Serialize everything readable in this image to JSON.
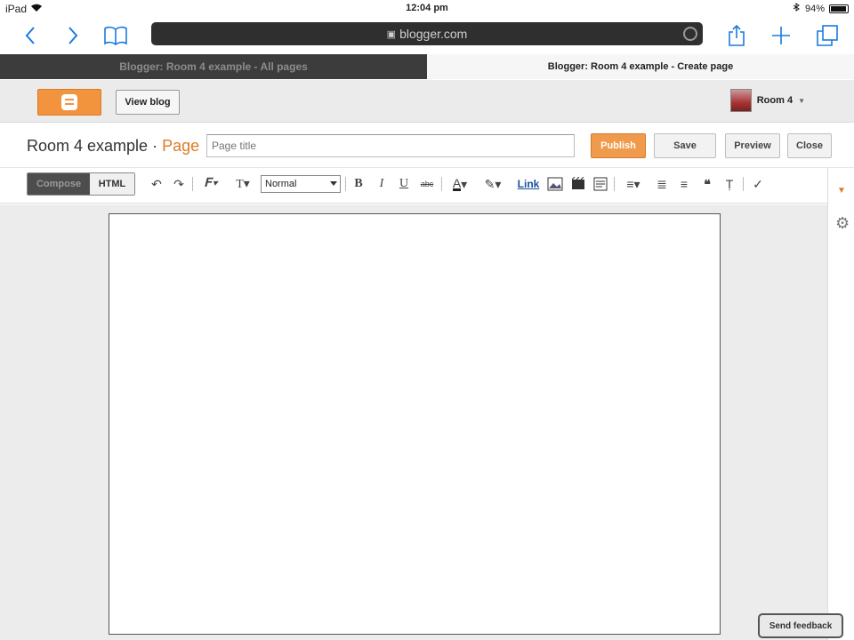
{
  "status_bar": {
    "device": "iPad",
    "time": "12:04 pm",
    "battery": "94%",
    "battery_level": 0.94
  },
  "safari": {
    "url": "blogger.com",
    "back_icon": "chevron-left-icon",
    "forward_icon": "chevron-right-icon",
    "bookmarks_icon": "book-icon",
    "share_icon": "share-icon",
    "new_tab_icon": "plus-icon",
    "tabs_icon": "tabs-icon"
  },
  "tabs": [
    {
      "title": "Blogger: Room 4 example - All pages"
    },
    {
      "title": "Blogger: Room 4 example - Create page"
    }
  ],
  "header": {
    "view_blog": "View blog",
    "account_name": "Room 4"
  },
  "title_row": {
    "blog_name": "Room 4 example",
    "separator": "·",
    "section": "Page",
    "title_placeholder": "Page title",
    "publish": "Publish",
    "save": "Save",
    "preview": "Preview",
    "close": "Close"
  },
  "toolbar": {
    "compose": "Compose",
    "html": "HTML",
    "paragraph_format": "Normal",
    "link": "Link"
  },
  "feedback": "Send feedback",
  "colors": {
    "accent": "#f09a4c",
    "brand_orange": "#dd7a25",
    "link": "#1a4fa0"
  }
}
